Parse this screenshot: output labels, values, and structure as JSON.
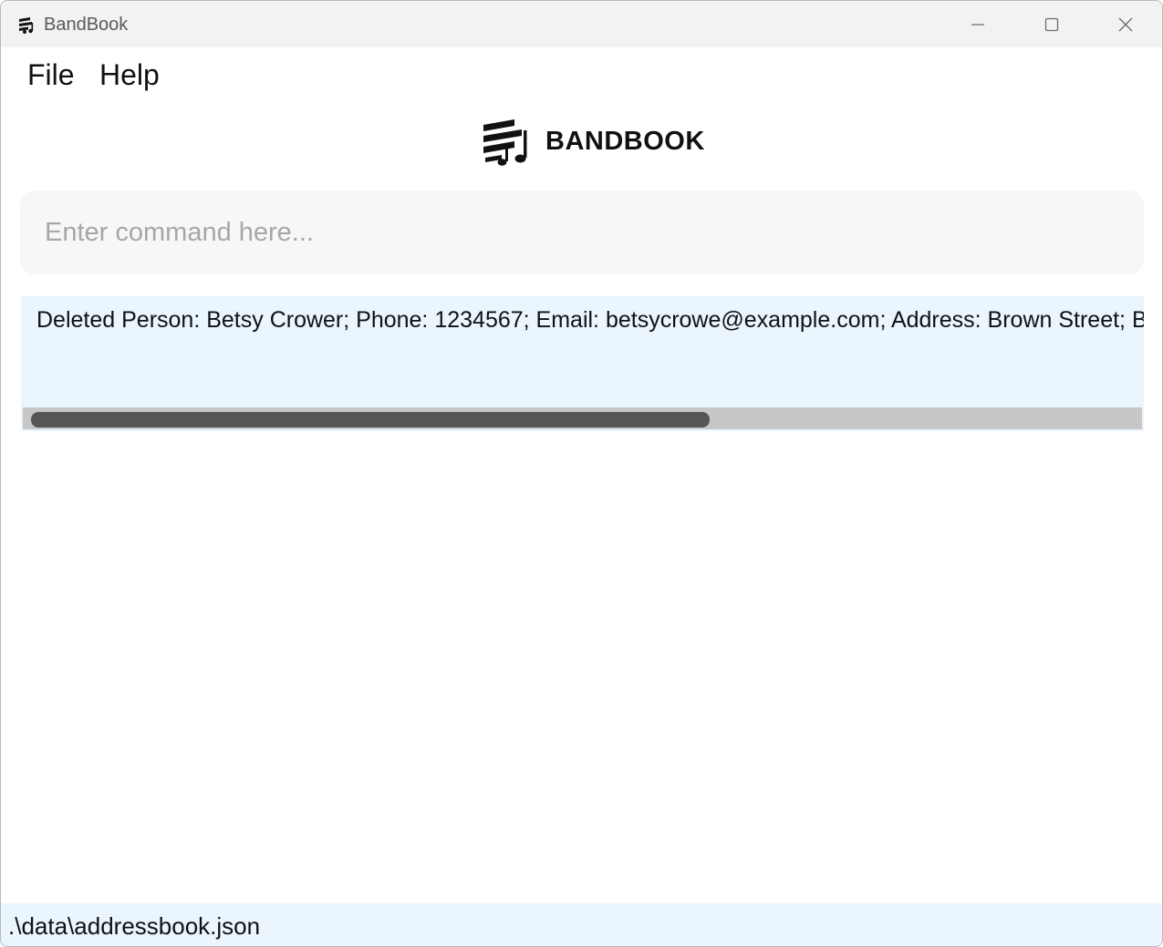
{
  "window": {
    "title": "BandBook"
  },
  "menu": {
    "file_label": "File",
    "help_label": "Help"
  },
  "logo": {
    "text": "BANDBOOK",
    "icon": "music-book-icon"
  },
  "command": {
    "value": "",
    "placeholder": "Enter command here..."
  },
  "result": {
    "text": "Deleted Person: Betsy Crower; Phone: 1234567; Email: betsycrowe@example.com; Address: Brown Street; Birth"
  },
  "status": {
    "file_path": ".\\data\\addressbook.json"
  },
  "colors": {
    "titlebar_bg": "#f2f2f2",
    "command_bg": "#f7f7f7",
    "result_bg": "#eaf5fd",
    "status_bg": "#eaf5fd",
    "scrollbar_track": "#c7c7c7",
    "scrollbar_thumb": "#555555"
  }
}
